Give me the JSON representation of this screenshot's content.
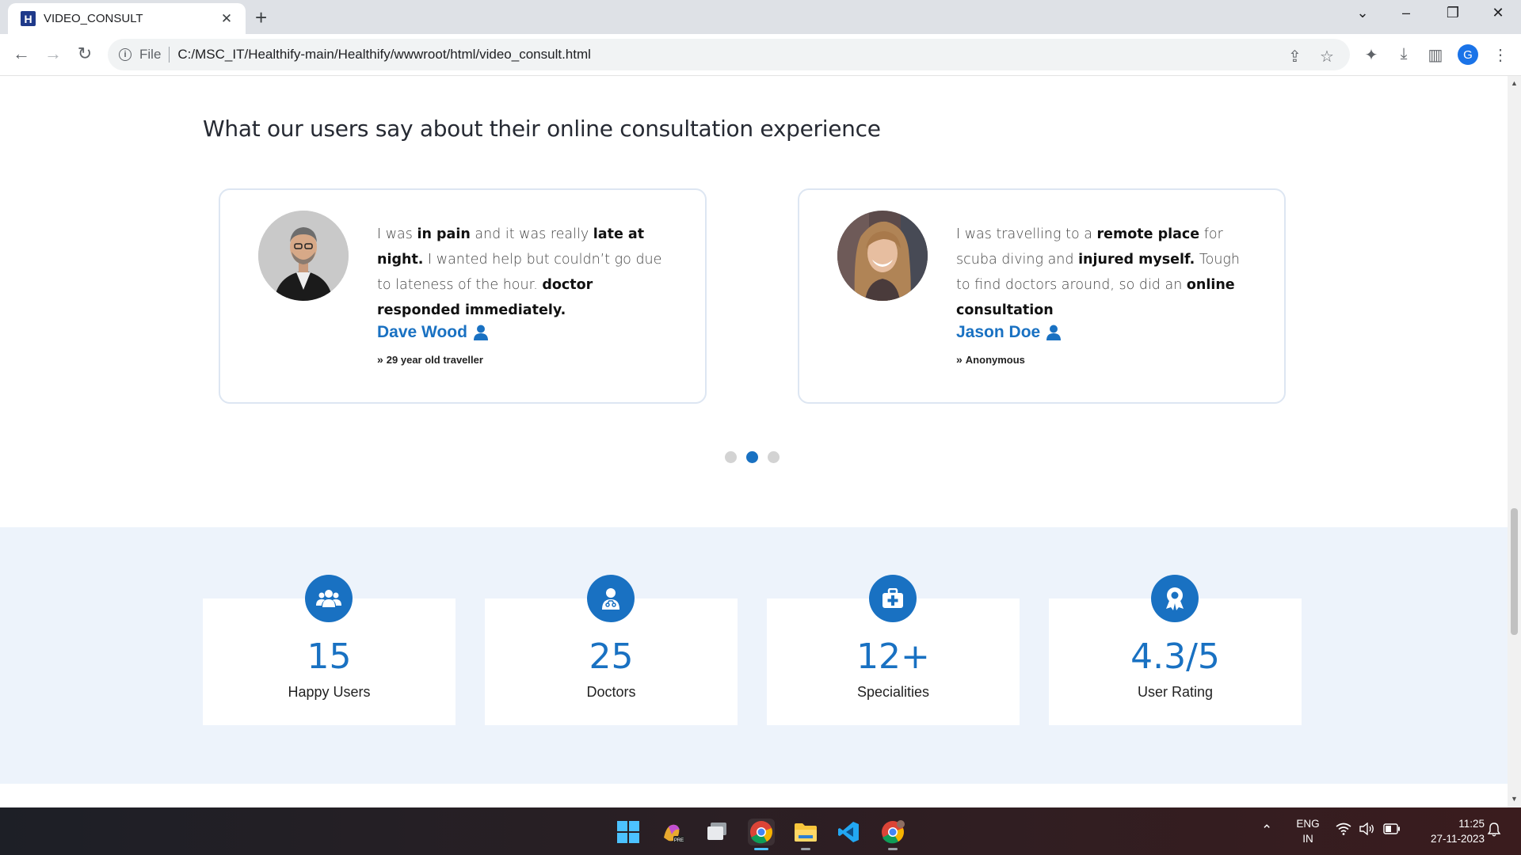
{
  "browser": {
    "tab_title": "VIDEO_CONSULT",
    "favicon_letter": "H",
    "file_label": "File",
    "url": "C:/MSC_IT/Healthify-main/Healthify/wwwroot/html/video_consult.html",
    "profile_initial": "G"
  },
  "page": {
    "section_title": "What our users say about their online consultation experience",
    "testimonials": [
      {
        "quote_parts": [
          "I was ",
          "in pain",
          " and it was really ",
          "late at night.",
          " I wanted help but couldn’t go due to lateness of the hour. ",
          "doctor responded immediately."
        ],
        "author": "Dave Wood",
        "role": "29 year old traveller"
      },
      {
        "quote_parts": [
          "I was travelling to a ",
          "remote place",
          " for scuba diving and ",
          "injured myself.",
          " Tough to find doctors around, so did an ",
          "online consultation"
        ],
        "author": "Jason Doe",
        "role": "Anonymous"
      }
    ],
    "carousel": {
      "dot_count": 3,
      "active_index": 1
    },
    "stats": [
      {
        "value": "15",
        "label": "Happy Users",
        "icon": "users-icon"
      },
      {
        "value": "25",
        "label": "Doctors",
        "icon": "doctor-icon"
      },
      {
        "value": "12+",
        "label": "Specialities",
        "icon": "medical-kit-icon"
      },
      {
        "value": "4.3/5",
        "label": "User Rating",
        "icon": "award-icon"
      }
    ],
    "accent_color": "#1971c2",
    "band_color": "#edf3fb"
  },
  "taskbar": {
    "language": "ENG",
    "region": "IN",
    "time": "11:25",
    "date": "27-11-2023"
  }
}
